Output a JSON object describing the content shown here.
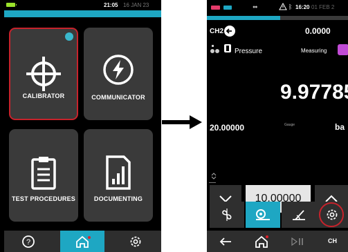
{
  "left_device": {
    "status": {
      "time": "21:05",
      "date": "16 JAN 23"
    },
    "tiles": {
      "calibrator": "CALIBRATOR",
      "communicator": "COMMUNICATOR",
      "test_procedures": "TEST PROCEDURES",
      "documenting": "DOCUMENTING"
    },
    "nav": {
      "help_icon": "question-icon",
      "home_icon": "home-icon",
      "settings_icon": "gear-icon"
    }
  },
  "arrow": {
    "icon": "right-arrow-icon"
  },
  "right_device": {
    "status": {
      "time": "16:20",
      "date": "01 FEB 2",
      "dots": "●●"
    },
    "channel": "CH2",
    "setpoint_top": "0.0000",
    "measure_type": "Pressure",
    "mode": "Measuring",
    "main_reading": "9.97785",
    "range_value": "20.00000",
    "gauge_label": "Gauge",
    "unit": "ba",
    "step_value": "10.00000",
    "nav": {
      "ch_label": "CH"
    }
  },
  "colors": {
    "accent": "#1ea7c3",
    "highlight": "#c8222b",
    "tile": "#3a3a3a",
    "measure": "#c24bd6"
  }
}
